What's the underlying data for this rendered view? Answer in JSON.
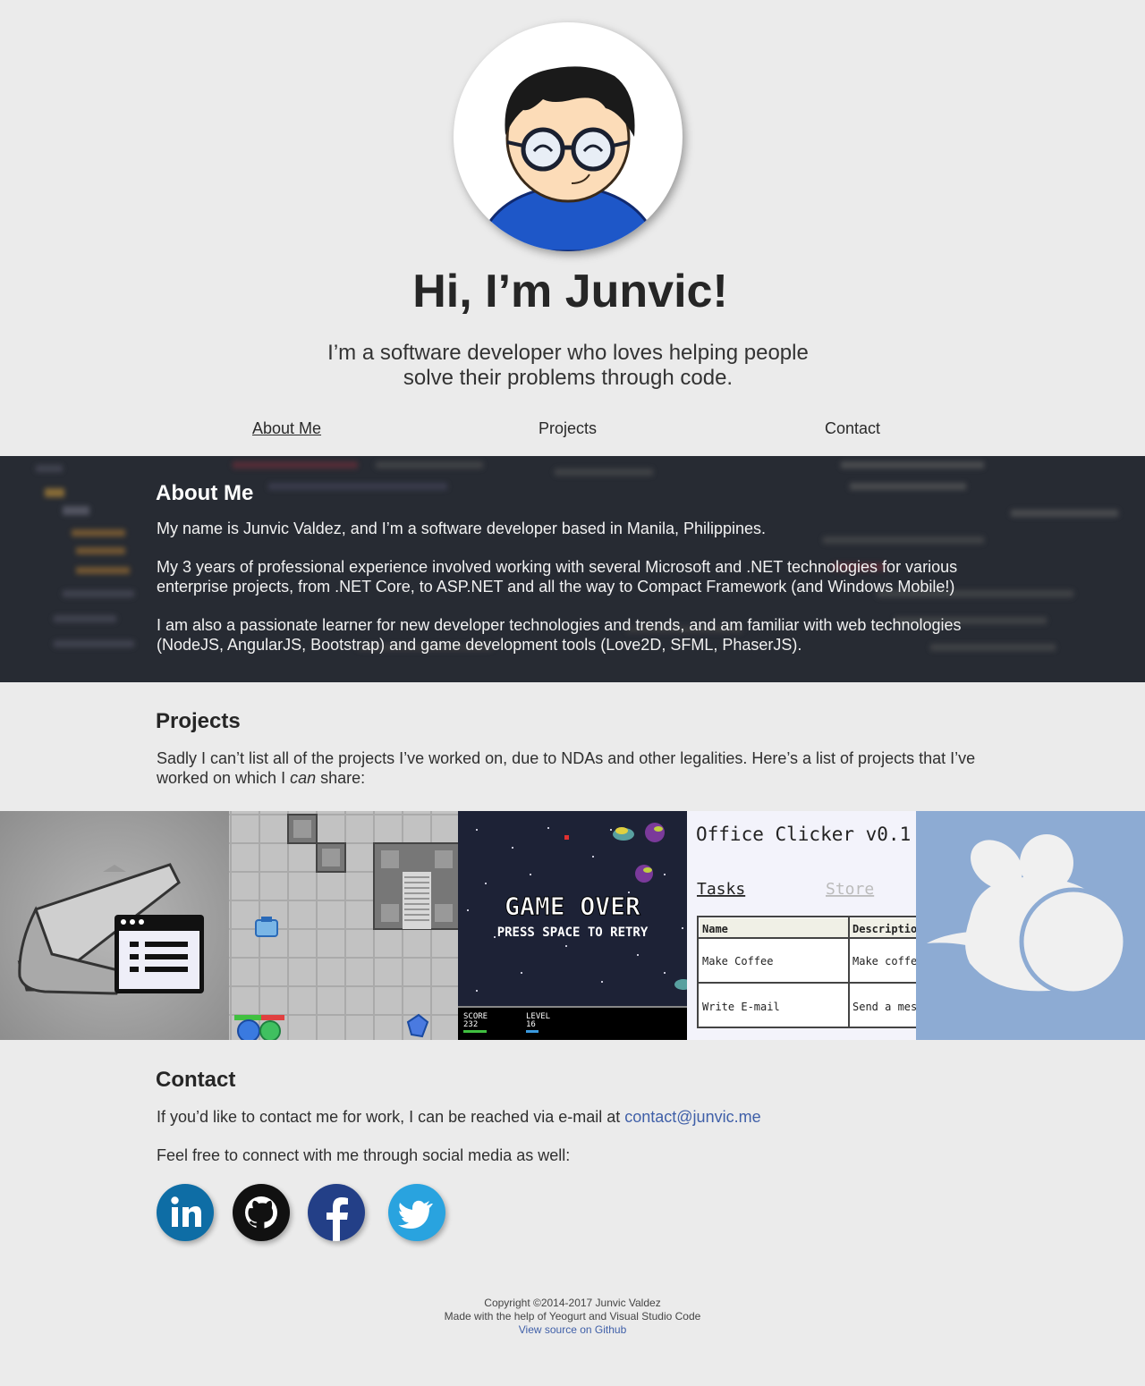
{
  "hero": {
    "title": "Hi, I’m Junvic!",
    "tagline": "I’m a software developer who loves helping people solve their problems through code."
  },
  "nav": {
    "items": [
      {
        "label": "About Me",
        "active": true
      },
      {
        "label": "Projects",
        "active": false
      },
      {
        "label": "Contact",
        "active": false
      }
    ]
  },
  "about": {
    "heading": "About Me",
    "paragraphs": [
      "My name is Junvic Valdez, and I’m a software developer based in Manila, Philippines.",
      "My 3 years of professional experience involved working with several Microsoft and .NET technologies for various enterprise projects, from .NET Core, to ASP.NET and all the way to Compact Framework (and Windows Mobile!)",
      "I am also a passionate learner for new developer technologies and trends, and am familiar with web technologies (NodeJS, AngularJS, Bootstrap) and game development tools (Love2D, SFML, PhaserJS)."
    ]
  },
  "projects": {
    "heading": "Projects",
    "intro_before": "Sadly I can’t list all of the projects I’ve worked on, due to NDAs and other legalities. Here’s a list of projects that I’ve worked on which I ",
    "intro_em": "can",
    "intro_after": " share:",
    "tiles": [
      {
        "icon": "storage-card-app-icon"
      },
      {
        "icon": "tank-game-icon"
      },
      {
        "icon": "space-shooter-game-icon",
        "game_over": "GAME OVER",
        "retry": "PRESS SPACE TO RETRY",
        "score_label": "SCORE",
        "score_value": "232",
        "level_label": "LEVEL",
        "level_value": "16"
      },
      {
        "icon": "office-clicker-icon",
        "title": "Office Clicker v0.1",
        "tab_tasks": "Tasks",
        "tab_store": "Store",
        "col_name": "Name",
        "col_desc": "Description",
        "rows": [
          {
            "name": "Make Coffee",
            "desc": "Make coffe"
          },
          {
            "name": "Write E-mail",
            "desc": "Send a mes"
          }
        ]
      },
      {
        "icon": "bird-logo-icon"
      }
    ]
  },
  "contact": {
    "heading": "Contact",
    "email_text": "If you’d like to contact me for work, I can be reached via e-mail at ",
    "email": "contact@junvic.me",
    "social_text": "Feel free to connect with me through social media as well:",
    "socials": [
      "linkedin-icon",
      "github-icon",
      "facebook-icon",
      "twitter-icon"
    ]
  },
  "footer": {
    "copyright": "Copyright ©2014-2017 Junvic Valdez",
    "made_with": "Made with the help of Yeogurt and Visual Studio Code",
    "source_link": "View source on Github"
  },
  "colors": {
    "background": "#ebebeb",
    "about_bg": "#272b33",
    "link": "#3f5fa8",
    "linkedin": "#0e6da5",
    "github": "#111111",
    "facebook": "#233f87",
    "twitter": "#29a3df",
    "bird_tile": "#8dabd3"
  }
}
